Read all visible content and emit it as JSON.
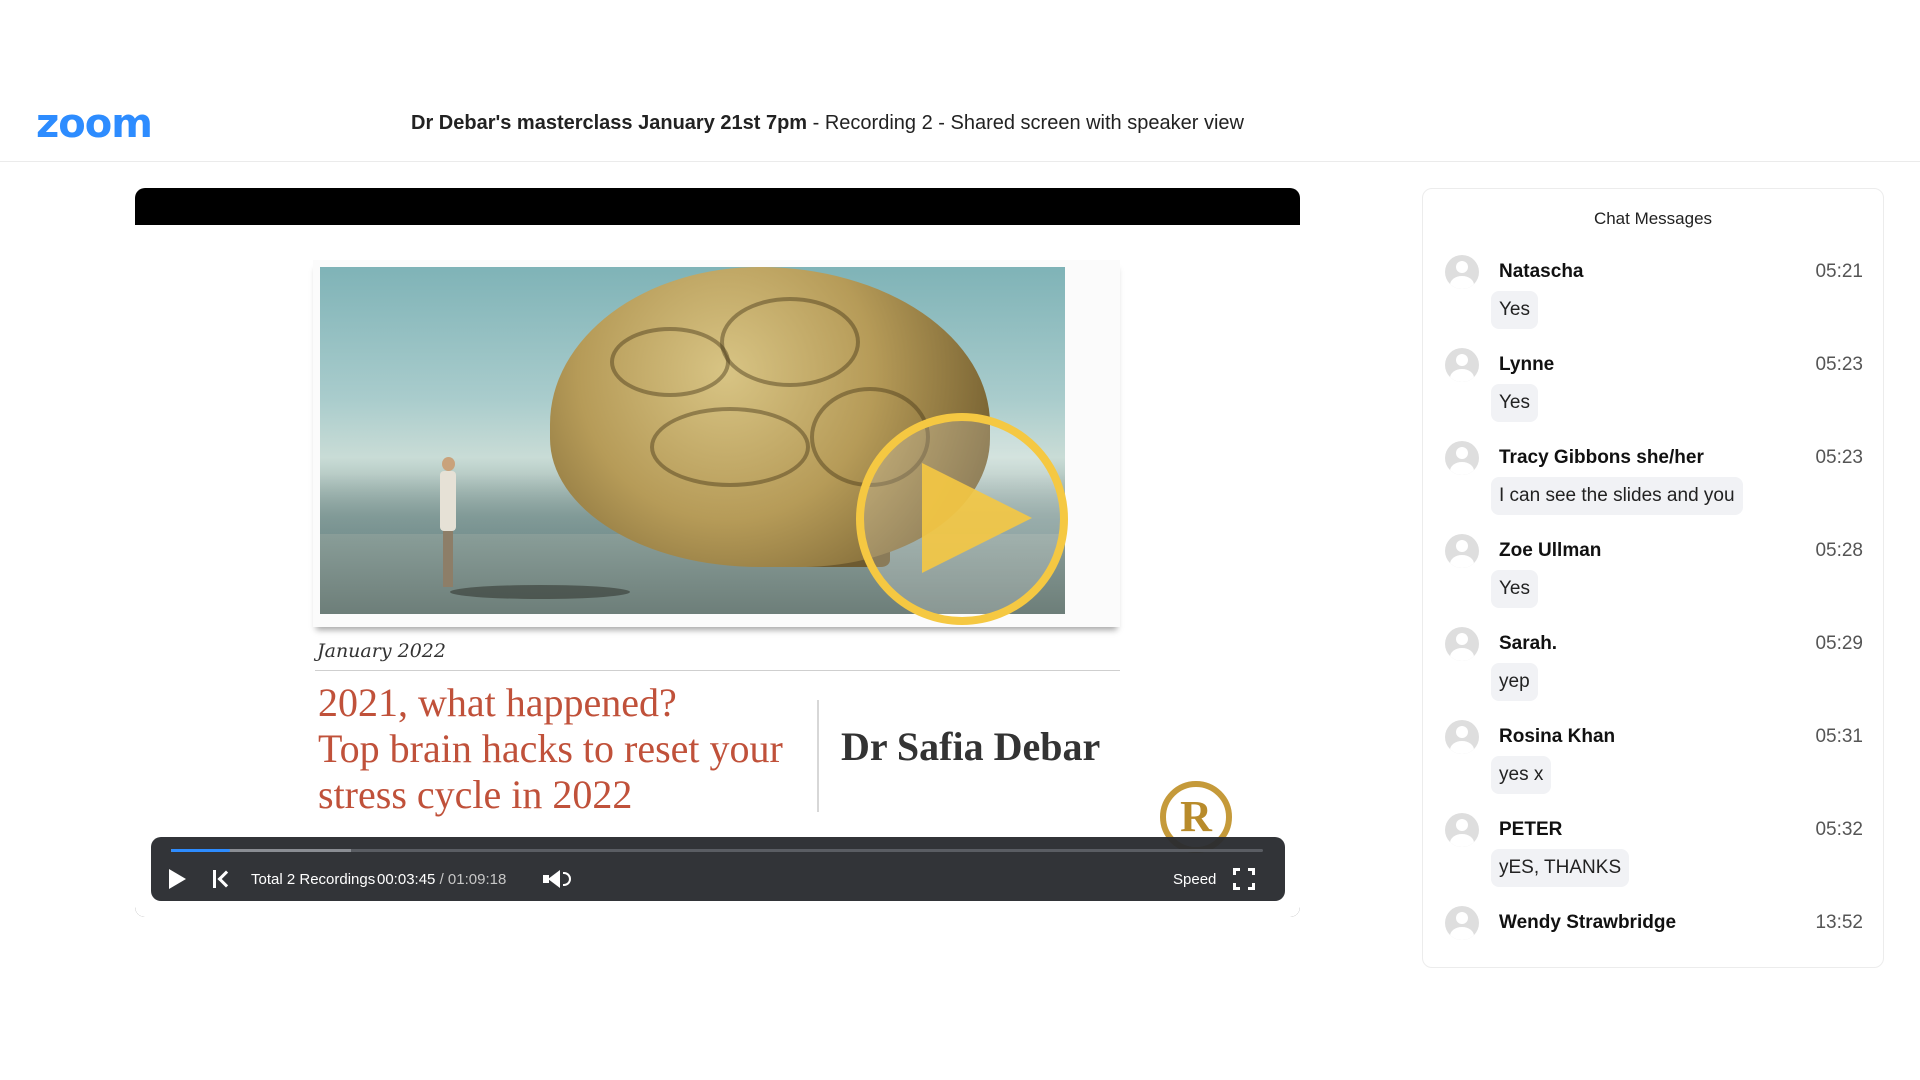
{
  "header": {
    "logo": "zoom",
    "title_strong": "Dr Debar's masterclass January 21st 7pm",
    "title_rest": " - Recording 2 - Shared screen with speaker view"
  },
  "slide": {
    "date": "January 2022",
    "headline_1": "2021, what happened?",
    "headline_2": "Top brain hacks to reset your stress cycle in 2022",
    "presenter": "Dr Safia Debar",
    "logo_letter": "R"
  },
  "player": {
    "total_recordings": "Total 2 Recordings",
    "current_time": "00:03:45",
    "separator": "/",
    "duration": "01:09:18",
    "speed_label": "Speed",
    "progress": 0.054,
    "accent": "#2d8cff"
  },
  "chat": {
    "title": "Chat Messages",
    "messages": [
      {
        "name": "Natascha",
        "time": "05:21",
        "text": "Yes"
      },
      {
        "name": "Lynne",
        "time": "05:23",
        "text": "Yes"
      },
      {
        "name": "Tracy Gibbons she/her",
        "time": "05:23",
        "text": "I can see the slides and you"
      },
      {
        "name": "Zoe Ullman",
        "time": "05:28",
        "text": "Yes"
      },
      {
        "name": "Sarah.",
        "time": "05:29",
        "text": "yep"
      },
      {
        "name": "Rosina Khan",
        "time": "05:31",
        "text": "yes x"
      },
      {
        "name": "PETER",
        "time": "05:32",
        "text": "yES, THANKS"
      },
      {
        "name": "Wendy Strawbridge",
        "time": "13:52",
        "text": ""
      }
    ]
  }
}
